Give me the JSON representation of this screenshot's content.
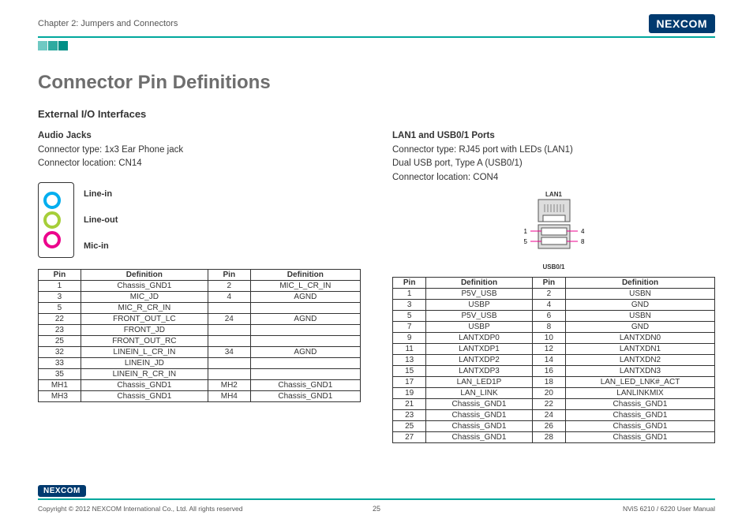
{
  "header": {
    "chapter": "Chapter 2: Jumpers and Connectors",
    "brand": "NEXCOM"
  },
  "title": "Connector Pin Definitions",
  "subsection": "External I/O Interfaces",
  "audio": {
    "heading": "Audio Jacks",
    "connector_type": "Connector type: 1x3 Ear Phone jack",
    "connector_location": "Connector location: CN14",
    "linein": "Line-in",
    "lineout": "Line-out",
    "micin": "Mic-in",
    "table_headers": {
      "pin": "Pin",
      "def": "Definition"
    },
    "rows": [
      {
        "p1": "1",
        "d1": "Chassis_GND1",
        "p2": "2",
        "d2": "MIC_L_CR_IN"
      },
      {
        "p1": "3",
        "d1": "MIC_JD",
        "p2": "4",
        "d2": "AGND"
      },
      {
        "p1": "5",
        "d1": "MIC_R_CR_IN",
        "p2": "",
        "d2": ""
      },
      {
        "p1": "22",
        "d1": "FRONT_OUT_LC",
        "p2": "24",
        "d2": "AGND"
      },
      {
        "p1": "23",
        "d1": "FRONT_JD",
        "p2": "",
        "d2": ""
      },
      {
        "p1": "25",
        "d1": "FRONT_OUT_RC",
        "p2": "",
        "d2": ""
      },
      {
        "p1": "32",
        "d1": "LINEIN_L_CR_IN",
        "p2": "34",
        "d2": "AGND"
      },
      {
        "p1": "33",
        "d1": "LINEIN_JD",
        "p2": "",
        "d2": ""
      },
      {
        "p1": "35",
        "d1": "LINEIN_R_CR_IN",
        "p2": "",
        "d2": ""
      },
      {
        "p1": "MH1",
        "d1": "Chassis_GND1",
        "p2": "MH2",
        "d2": "Chassis_GND1"
      },
      {
        "p1": "MH3",
        "d1": "Chassis_GND1",
        "p2": "MH4",
        "d2": "Chassis_GND1"
      }
    ]
  },
  "lanusb": {
    "heading": "LAN1 and USB0/1 Ports",
    "line1": "Connector type: RJ45 port with LEDs (LAN1)",
    "line2": "Dual USB port, Type A (USB0/1)",
    "line3": "Connector location: CON4",
    "diagram_lan": "LAN1",
    "diagram_usb": "USB0/1",
    "pin1": "1",
    "pin4": "4",
    "pin5": "5",
    "pin8": "8",
    "table_headers": {
      "pin": "Pin",
      "def": "Definition"
    },
    "rows": [
      {
        "p1": "1",
        "d1": "P5V_USB",
        "p2": "2",
        "d2": "USBN"
      },
      {
        "p1": "3",
        "d1": "USBP",
        "p2": "4",
        "d2": "GND"
      },
      {
        "p1": "5",
        "d1": "P5V_USB",
        "p2": "6",
        "d2": "USBN"
      },
      {
        "p1": "7",
        "d1": "USBP",
        "p2": "8",
        "d2": "GND"
      },
      {
        "p1": "9",
        "d1": "LANTXDP0",
        "p2": "10",
        "d2": "LANTXDN0"
      },
      {
        "p1": "11",
        "d1": "LANTXDP1",
        "p2": "12",
        "d2": "LANTXDN1"
      },
      {
        "p1": "13",
        "d1": "LANTXDP2",
        "p2": "14",
        "d2": "LANTXDN2"
      },
      {
        "p1": "15",
        "d1": "LANTXDP3",
        "p2": "16",
        "d2": "LANTXDN3"
      },
      {
        "p1": "17",
        "d1": "LAN_LED1P",
        "p2": "18",
        "d2": "LAN_LED_LNK#_ACT"
      },
      {
        "p1": "19",
        "d1": "LAN_LINK",
        "p2": "20",
        "d2": "LANLINKMIX"
      },
      {
        "p1": "21",
        "d1": "Chassis_GND1",
        "p2": "22",
        "d2": "Chassis_GND1"
      },
      {
        "p1": "23",
        "d1": "Chassis_GND1",
        "p2": "24",
        "d2": "Chassis_GND1"
      },
      {
        "p1": "25",
        "d1": "Chassis_GND1",
        "p2": "26",
        "d2": "Chassis_GND1"
      },
      {
        "p1": "27",
        "d1": "Chassis_GND1",
        "p2": "28",
        "d2": "Chassis_GND1"
      }
    ]
  },
  "footer": {
    "copyright": "Copyright © 2012 NEXCOM International Co., Ltd. All rights reserved",
    "page": "25",
    "manual": "NViS 6210 / 6220 User Manual",
    "brand": "NEXCOM"
  }
}
